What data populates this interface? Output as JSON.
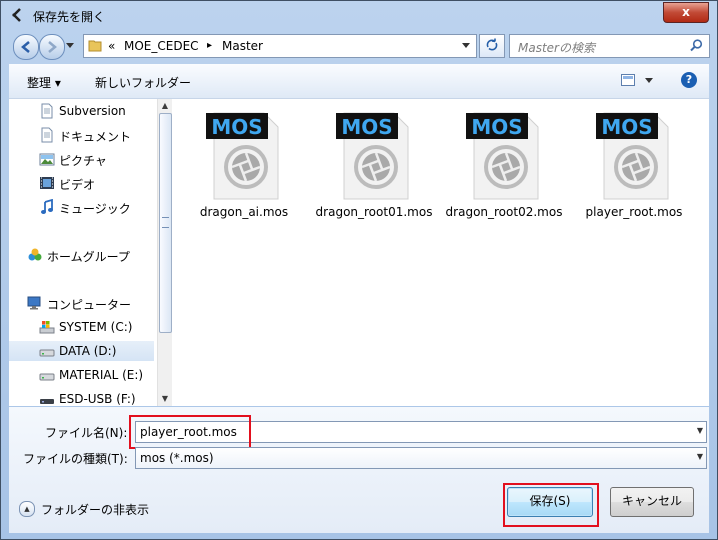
{
  "window": {
    "title": "保存先を開く",
    "close_label": "x",
    "colors": {
      "frame": "#a7c3e6",
      "accent": "#1b5fb2",
      "highlight_box": "#e20f1e"
    }
  },
  "nav": {
    "back_icon": "back-arrow-icon",
    "forward_icon": "forward-arrow-icon",
    "address": {
      "overflow": "«",
      "segment1": "MOE_CEDEC",
      "separator": "▸",
      "segment2": "Master"
    },
    "search_placeholder": "Masterの検索"
  },
  "toolbar": {
    "organize_label": "整理 ▾",
    "new_folder_label": "新しいフォルダー"
  },
  "sidebar": {
    "items": [
      {
        "label": "Subversion",
        "icon": "document-icon"
      },
      {
        "label": "ドキュメント",
        "icon": "document-icon"
      },
      {
        "label": "ピクチャ",
        "icon": "picture-icon"
      },
      {
        "label": "ビデオ",
        "icon": "video-icon"
      },
      {
        "label": "ミュージック",
        "icon": "music-icon"
      },
      {
        "label": "ホームグループ",
        "icon": "homegroup-icon"
      },
      {
        "label": "コンピューター",
        "icon": "computer-icon"
      },
      {
        "label": "SYSTEM (C:)",
        "icon": "system-drive-icon"
      },
      {
        "label": "DATA (D:)",
        "icon": "drive-icon"
      },
      {
        "label": "MATERIAL (E:)",
        "icon": "drive-icon"
      },
      {
        "label": "ESD-USB (F:)",
        "icon": "usb-drive-icon"
      }
    ],
    "scroll_grip": "≡"
  },
  "files": {
    "badge": "MOS",
    "items": [
      {
        "name": "dragon_ai.mos"
      },
      {
        "name": "dragon_root01.mos"
      },
      {
        "name": "dragon_root02.mos"
      },
      {
        "name": "player_root.mos"
      }
    ]
  },
  "form": {
    "filename_label": "ファイル名(N):",
    "filename_value": "player_root.mos",
    "filetype_label": "ファイルの種類(T):",
    "filetype_value": "mos (*.mos)",
    "hide_folders_label": "フォルダーの非表示",
    "save_label": "保存(S)",
    "cancel_label": "キャンセル"
  }
}
